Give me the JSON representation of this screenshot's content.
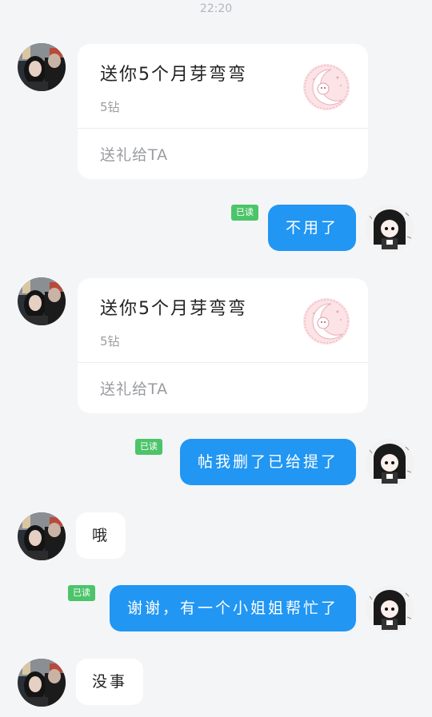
{
  "header": {
    "timestamp": "22:20"
  },
  "messages": [
    {
      "type": "gift",
      "title": "送你5个月芽弯弯",
      "price": "5钻",
      "action": "送礼给TA"
    },
    {
      "type": "text_out",
      "text": "不用了",
      "read_badge": "已读"
    },
    {
      "type": "gift",
      "title": "送你5个月芽弯弯",
      "price": "5钻",
      "action": "送礼给TA"
    },
    {
      "type": "text_out",
      "text": "帖我删了已给提了",
      "read_badge": "已读"
    },
    {
      "type": "text_in",
      "text": "哦"
    },
    {
      "type": "text_out",
      "text": "谢谢，有一个小姐姐帮忙了",
      "read_badge": "已读"
    },
    {
      "type": "text_in",
      "text": "没事"
    }
  ],
  "colors": {
    "background": "#f4f5f7",
    "bubble_out": "#2196f3",
    "bubble_in": "#ffffff",
    "read_badge": "#4cc46a",
    "muted_text": "#9a9ca1"
  },
  "icons": {
    "gift_icon": "crescent-moon-icon",
    "sender_avatar": "avatar-photo",
    "my_avatar": "anime-girl-avatar"
  }
}
